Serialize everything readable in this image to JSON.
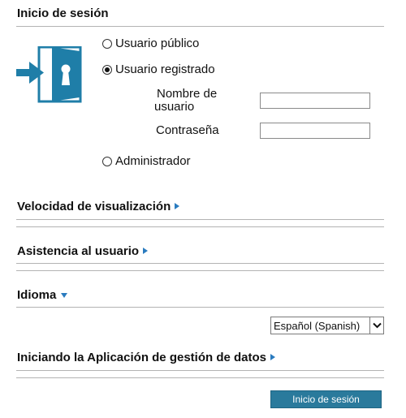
{
  "login_section": {
    "title": "Inicio de sesión",
    "options": {
      "public_user": "Usuario público",
      "registered_user": "Usuario registrado",
      "administrator": "Administrador"
    },
    "selected_option": "registered_user",
    "username_label_line1": "Nombre de",
    "username_label_line2": "usuario",
    "username_value": "",
    "password_label": "Contraseña",
    "password_value": "",
    "icon": "login-door-keyhole-icon"
  },
  "display_speed": {
    "title": "Velocidad de visualización",
    "icon": "expand-arrow-right-icon"
  },
  "user_assistance": {
    "title": "Asistencia al usuario",
    "icon": "expand-arrow-right-icon"
  },
  "language": {
    "title": "Idioma",
    "icon": "collapse-arrow-down-icon",
    "selected": "Español (Spanish)"
  },
  "data_management": {
    "title": "Iniciando la Aplicación de gestión de datos",
    "icon": "expand-arrow-right-icon"
  },
  "login_button": "Inicio de sesión",
  "colors": {
    "accent": "#2a7bbf",
    "icon_teal": "#1f7ea8",
    "button": "#2a7a9c"
  }
}
